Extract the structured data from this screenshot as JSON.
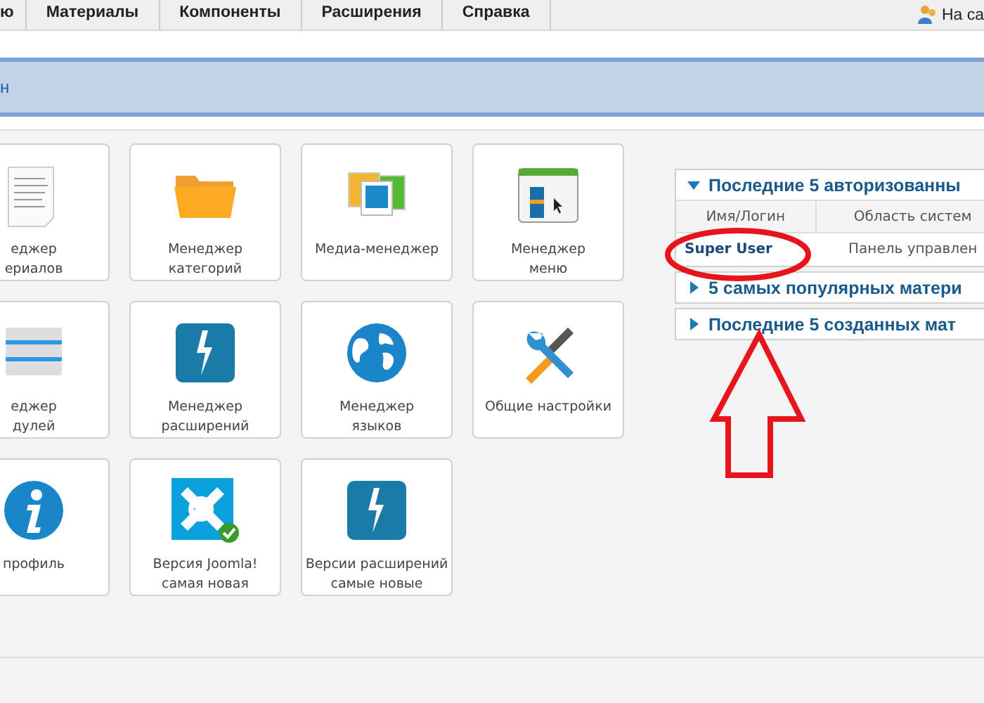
{
  "menu": {
    "items": [
      {
        "label": "ю"
      },
      {
        "label": "Материалы"
      },
      {
        "label": "Компоненты"
      },
      {
        "label": "Расширения"
      },
      {
        "label": "Справка"
      }
    ],
    "site_link": "На са"
  },
  "banner": {
    "title": "н"
  },
  "tiles": [
    {
      "kind": "document",
      "lines": [
        "еджер",
        "ериалов"
      ]
    },
    {
      "kind": "folder",
      "lines": [
        "Менеджер",
        "категорий"
      ]
    },
    {
      "kind": "media",
      "lines": [
        "Медиа-менеджер"
      ]
    },
    {
      "kind": "window",
      "lines": [
        "Менеджер",
        "меню"
      ]
    },
    {
      "kind": "stack",
      "lines": [
        "еджер",
        "дулей"
      ]
    },
    {
      "kind": "bolt",
      "lines": [
        "Менеджер",
        "расширений"
      ]
    },
    {
      "kind": "globe",
      "lines": [
        "Менеджер",
        "языков"
      ]
    },
    {
      "kind": "tools",
      "lines": [
        "Общие настройки"
      ]
    },
    {
      "kind": "info",
      "lines": [
        "профиль"
      ]
    },
    {
      "kind": "joomla",
      "lines": [
        "Версия Joomla!",
        "самая новая"
      ]
    },
    {
      "kind": "bolt",
      "lines": [
        "Версии расширений",
        "самые новые"
      ]
    }
  ],
  "panels": [
    {
      "title": "Последние 5 авторизованны",
      "expanded": true,
      "columns": [
        "Имя/Логин",
        "Область систем"
      ],
      "rows": [
        [
          "Super User",
          "Панель управлен"
        ]
      ]
    },
    {
      "title": "5 самых популярных матери",
      "expanded": false
    },
    {
      "title": "Последние 5 созданных мат",
      "expanded": false
    }
  ],
  "annotation": {
    "kind": "circle-and-arrow"
  }
}
